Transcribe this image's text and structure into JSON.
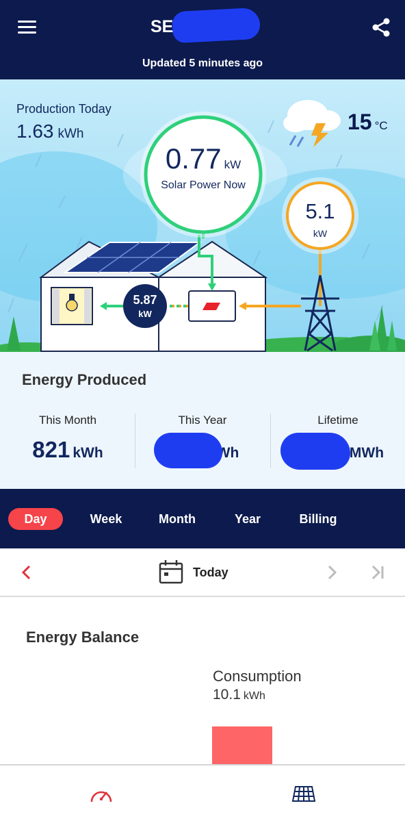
{
  "header": {
    "site_title": "SE",
    "updated": "Updated 5 minutes ago",
    "menu_icon": "hamburger-menu-icon",
    "share_icon": "share-icon"
  },
  "hero": {
    "production_label": "Production Today",
    "production_value": "1.63",
    "production_unit": "kWh",
    "temperature": "15",
    "temperature_unit": "°C",
    "weather_icon": "thunderstorm-icon",
    "solar_power_value": "0.77",
    "solar_power_unit": "kW",
    "solar_power_label": "Solar Power Now",
    "grid_value": "5.1",
    "grid_unit": "kW",
    "load_value": "5.87",
    "load_unit": "kW"
  },
  "energy_produced": {
    "title": "Energy Produced",
    "this_month_label": "This Month",
    "this_month_value": "821",
    "this_month_unit": "kWh",
    "this_year_label": "This Year",
    "this_year_unit": "Wh",
    "lifetime_label": "Lifetime",
    "lifetime_unit": "MWh"
  },
  "tabs": {
    "day": "Day",
    "week": "Week",
    "month": "Month",
    "year": "Year",
    "billing": "Billing",
    "active": "Day"
  },
  "date_nav": {
    "label": "Today"
  },
  "energy_balance": {
    "title": "Energy Balance",
    "consumption_label": "Consumption",
    "consumption_value": "10.1",
    "consumption_unit": "kWh"
  },
  "colors": {
    "navy": "#0c1a4d",
    "accent_red": "#f5444a",
    "solar_green": "#2fd07a",
    "grid_orange": "#f5a623",
    "consumption_bar": "#fe6566"
  },
  "bottom_nav": {
    "items": [
      "dashboard-gauge-icon",
      "solar-panel-layout-icon"
    ]
  }
}
